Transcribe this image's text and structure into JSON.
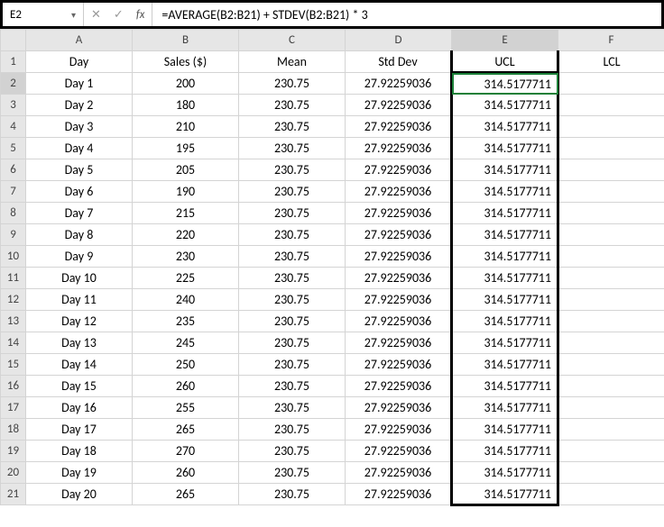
{
  "namebox": "E2",
  "formula": "=AVERAGE(B2:B21) + STDEV(B2:B21) * 3",
  "columns": [
    "A",
    "B",
    "C",
    "D",
    "E",
    "F"
  ],
  "selectedCol": "E",
  "selectedRow": 2,
  "headers": {
    "A": "Day",
    "B": "Sales ($)",
    "C": "Mean",
    "D": "Std Dev",
    "E": "UCL",
    "F": "LCL"
  },
  "constCols": {
    "C": "230.75",
    "D": "27.92259036",
    "E": "314.5177711",
    "F": ""
  },
  "rows": [
    {
      "n": 2,
      "A": "Day 1",
      "B": "200"
    },
    {
      "n": 3,
      "A": "Day 2",
      "B": "180"
    },
    {
      "n": 4,
      "A": "Day 3",
      "B": "210"
    },
    {
      "n": 5,
      "A": "Day 4",
      "B": "195"
    },
    {
      "n": 6,
      "A": "Day 5",
      "B": "205"
    },
    {
      "n": 7,
      "A": "Day 6",
      "B": "190"
    },
    {
      "n": 8,
      "A": "Day 7",
      "B": "215"
    },
    {
      "n": 9,
      "A": "Day 8",
      "B": "220"
    },
    {
      "n": 10,
      "A": "Day 9",
      "B": "230"
    },
    {
      "n": 11,
      "A": "Day 10",
      "B": "225"
    },
    {
      "n": 12,
      "A": "Day 11",
      "B": "240"
    },
    {
      "n": 13,
      "A": "Day 12",
      "B": "235"
    },
    {
      "n": 14,
      "A": "Day 13",
      "B": "245"
    },
    {
      "n": 15,
      "A": "Day 14",
      "B": "250"
    },
    {
      "n": 16,
      "A": "Day 15",
      "B": "260"
    },
    {
      "n": 17,
      "A": "Day 16",
      "B": "255"
    },
    {
      "n": 18,
      "A": "Day 17",
      "B": "265"
    },
    {
      "n": 19,
      "A": "Day 18",
      "B": "270"
    },
    {
      "n": 20,
      "A": "Day 19",
      "B": "260"
    },
    {
      "n": 21,
      "A": "Day 20",
      "B": "265"
    }
  ],
  "icons": {
    "cancel": "✕",
    "confirm": "✓",
    "fx": "fx",
    "dd": "▾"
  }
}
